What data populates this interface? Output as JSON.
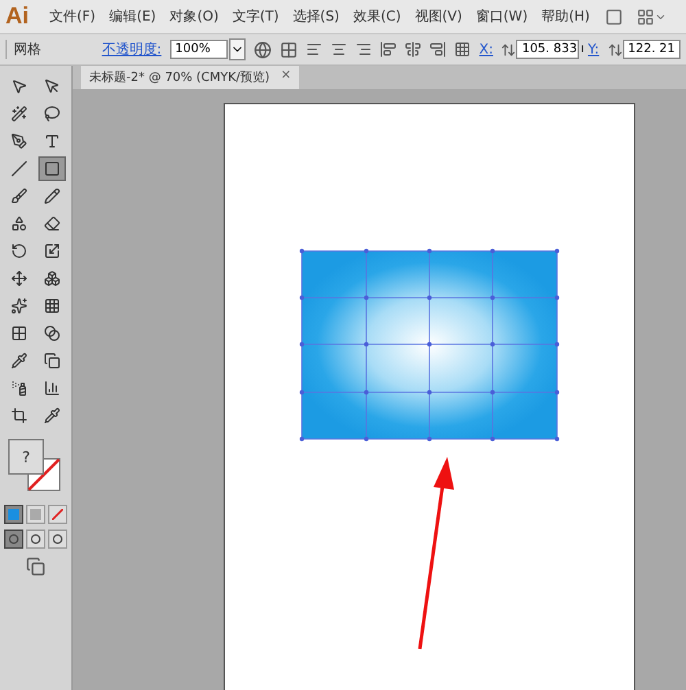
{
  "app": {
    "logo": "Ai"
  },
  "menu": [
    "文件(F)",
    "编辑(E)",
    "对象(O)",
    "文字(T)",
    "选择(S)",
    "效果(C)",
    "视图(V)",
    "窗口(W)",
    "帮助(H)"
  ],
  "control_bar": {
    "selection": "网格",
    "opacity_label": "不透明度:",
    "opacity_value": "100%",
    "x_label": "X:",
    "x_value": "105. 833 ı",
    "y_label": "Y:",
    "y_value": "122. 21"
  },
  "document_tab": {
    "title": "未标题-2* @ 70% (CMYK/预览)",
    "close": "×"
  },
  "tools": [
    {
      "selected": false
    },
    {
      "selected": false
    },
    {
      "selected": false
    },
    {
      "selected": false
    },
    {
      "selected": false
    },
    {
      "selected": false
    },
    {
      "selected": false
    },
    {
      "selected": true
    },
    {
      "selected": false
    },
    {
      "selected": false
    },
    {
      "selected": false
    },
    {
      "selected": false
    },
    {
      "selected": false
    },
    {
      "selected": false
    },
    {
      "selected": false
    },
    {
      "selected": false
    },
    {
      "selected": false
    },
    {
      "selected": false
    },
    {
      "selected": false
    },
    {
      "selected": false
    },
    {
      "selected": false
    },
    {
      "selected": false
    },
    {
      "selected": false
    },
    {
      "selected": false
    },
    {
      "selected": false
    },
    {
      "selected": false
    }
  ],
  "fill_swatch": {
    "label": "?"
  },
  "color_modes": [
    {
      "selected": true
    },
    {
      "selected": false
    },
    {
      "selected": false
    }
  ],
  "draw_modes": [
    {
      "selected": true
    },
    {
      "selected": false
    },
    {
      "selected": false
    }
  ]
}
